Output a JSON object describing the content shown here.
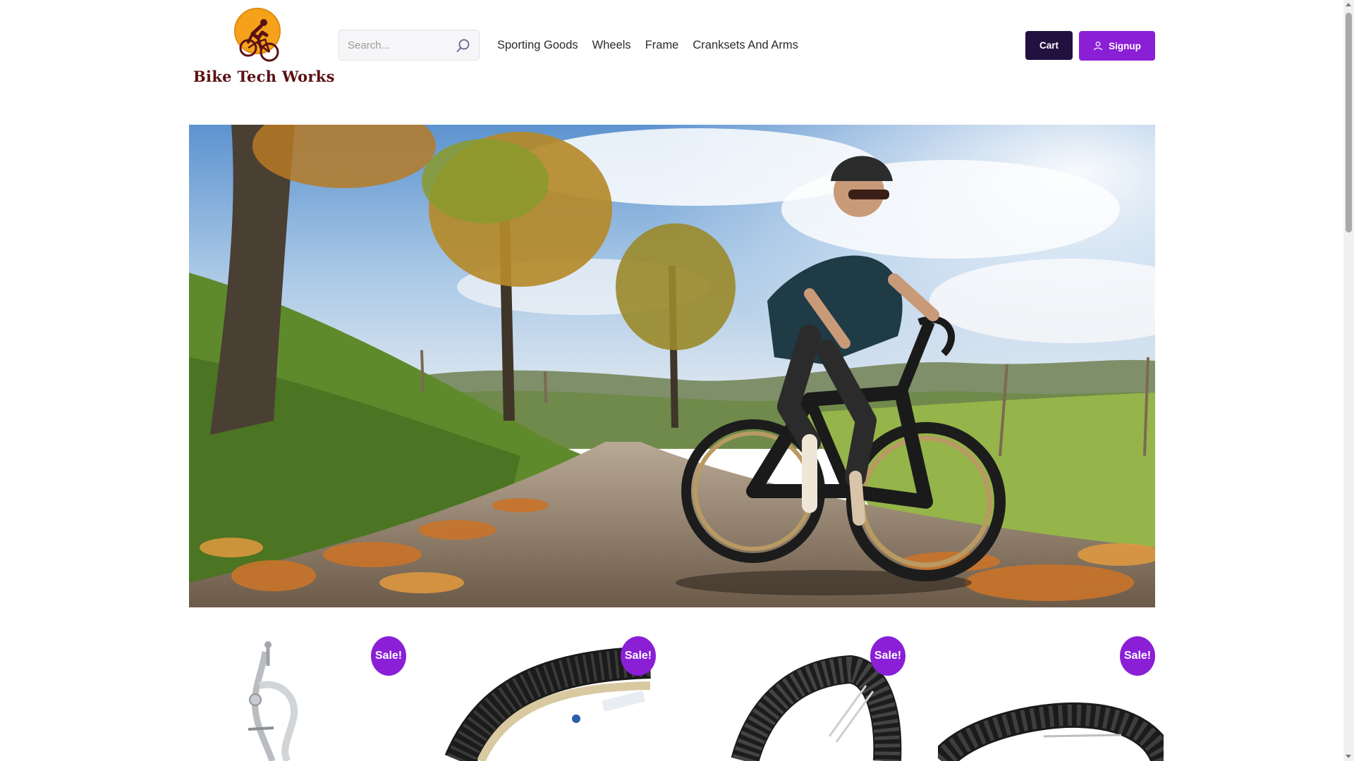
{
  "brand": {
    "name": "Bike Tech Works",
    "emblem_colors": {
      "sun": "#f5a21a",
      "rider": "#5a1013"
    }
  },
  "search": {
    "placeholder": "Search...",
    "icon": "search-icon"
  },
  "nav": {
    "items": [
      {
        "label": "Sporting Goods"
      },
      {
        "label": "Wheels"
      },
      {
        "label": "Frame"
      },
      {
        "label": "Cranksets And Arms"
      }
    ]
  },
  "actions": {
    "cart_label": "Cart",
    "signup_label": "Signup",
    "signup_icon": "user-icon"
  },
  "hero": {
    "image": "road-cyclist-autumn-lane"
  },
  "products": [
    {
      "badge": "Sale!",
      "image": "caliper-brake"
    },
    {
      "badge": "Sale!",
      "image": "gravel-tire"
    },
    {
      "badge": "Sale!",
      "image": "mezcal-tire"
    },
    {
      "badge": "Sale!",
      "image": "mtb-tire"
    }
  ],
  "colors": {
    "accent": "#8a1fd6",
    "cart_bg": "#22103f"
  }
}
